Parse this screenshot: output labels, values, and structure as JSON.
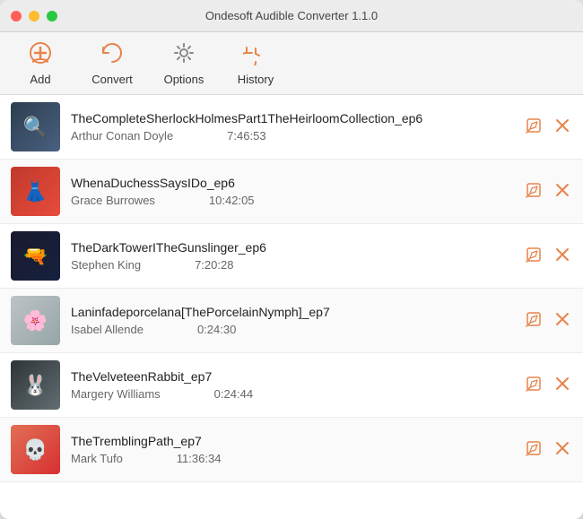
{
  "window": {
    "title": "Ondesoft Audible Converter 1.1.0"
  },
  "toolbar": {
    "add_label": "Add",
    "convert_label": "Convert",
    "options_label": "Options",
    "history_label": "History"
  },
  "items": [
    {
      "id": 1,
      "title": "TheCompleteSherlockHolmesPart1TheHeirloomCollection_ep6",
      "author": "Arthur Conan Doyle",
      "duration": "7:46:53",
      "art_class": "album-art-1",
      "art_emoji": "🔍"
    },
    {
      "id": 2,
      "title": "WhenaDuchessSaysIDo_ep6",
      "author": "Grace Burrowes",
      "duration": "10:42:05",
      "art_class": "album-art-2",
      "art_emoji": "👗"
    },
    {
      "id": 3,
      "title": "TheDarkTowerITheGunslinger_ep6",
      "author": "Stephen King",
      "duration": "7:20:28",
      "art_class": "album-art-3",
      "art_emoji": "🔫"
    },
    {
      "id": 4,
      "title": "Laninfadeporcelana[ThePorcelainNymph]_ep7",
      "author": "Isabel Allende",
      "duration": "0:24:30",
      "art_class": "album-art-4",
      "art_emoji": "🌸"
    },
    {
      "id": 5,
      "title": "TheVelveteenRabbit_ep7",
      "author": "Margery Williams",
      "duration": "0:24:44",
      "art_class": "album-art-5",
      "art_emoji": "🐰"
    },
    {
      "id": 6,
      "title": "TheTremblingPath_ep7",
      "author": "Mark Tufo",
      "duration": "11:36:34",
      "art_class": "album-art-6",
      "art_emoji": "💀"
    }
  ],
  "actions": {
    "edit_symbol": "✎",
    "delete_symbol": "✕"
  }
}
